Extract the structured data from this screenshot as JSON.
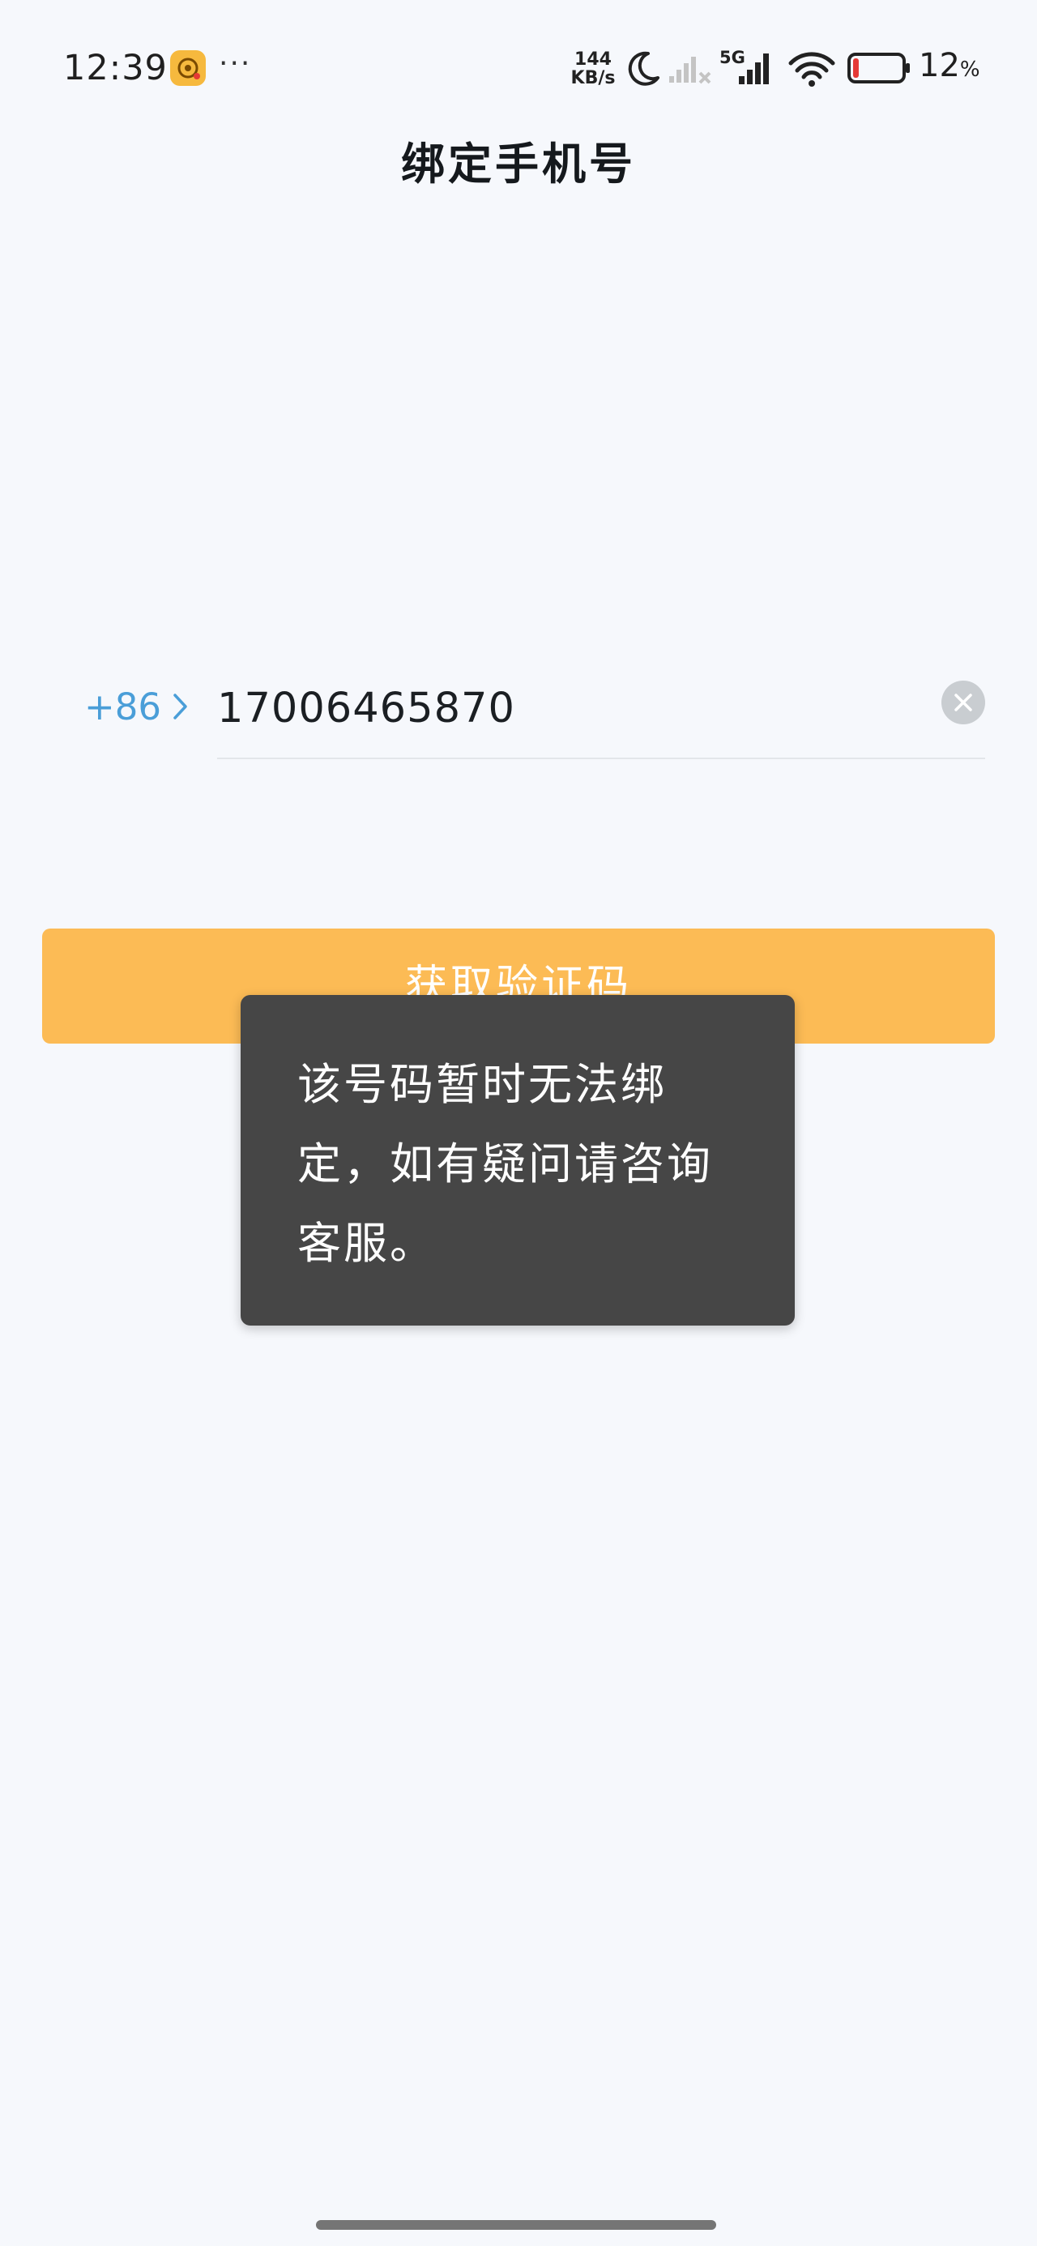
{
  "status_bar": {
    "time": "12:39",
    "more": "···",
    "speed_value": "144",
    "speed_unit": "KB/s",
    "network": "5G",
    "battery_value": "12",
    "battery_unit": "%",
    "battery_level": 0.12,
    "battery_color": "#e53935",
    "icons": [
      "app-notification-icon",
      "moon-icon",
      "no-signal-icon",
      "signal-5g-icon",
      "wifi-icon",
      "battery-icon"
    ]
  },
  "header": {
    "title": "绑定手机号"
  },
  "phone": {
    "country_code": "+86",
    "number": "17006465870",
    "clear_icon": "close-icon"
  },
  "button": {
    "label": "获取验证码"
  },
  "toast": {
    "lines": [
      "该号码暂时无法绑",
      "定，如有疑问请咨询",
      "客服。"
    ]
  },
  "colors": {
    "background": "#f6f8fc",
    "accent": "#fcbb55",
    "link": "#4a9ed8",
    "toast_bg": "#464646"
  }
}
